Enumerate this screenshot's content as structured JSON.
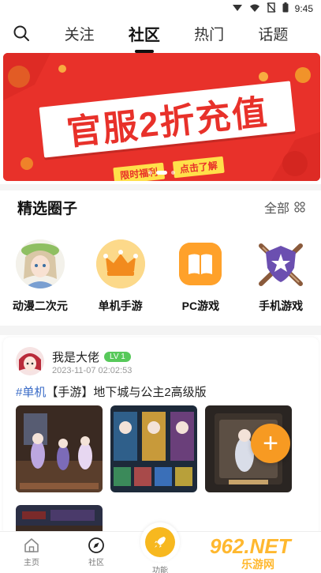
{
  "status_bar": {
    "time": "9:45"
  },
  "top_nav": {
    "tabs": [
      {
        "label": "关注"
      },
      {
        "label": "社区",
        "active": true
      },
      {
        "label": "热门"
      },
      {
        "label": "话题"
      }
    ]
  },
  "banner": {
    "title": "官服2折充值",
    "tags": [
      "限时福利",
      "点击了解"
    ],
    "colors": {
      "background": "#e8312a",
      "accent": "#ffe04a"
    }
  },
  "featured": {
    "title": "精选圈子",
    "view_all": "全部",
    "circles": [
      {
        "label": "动漫二次元",
        "icon": "anime-girl-avatar"
      },
      {
        "label": "单机手游",
        "icon": "crown-icon"
      },
      {
        "label": "PC游戏",
        "icon": "book-icon"
      },
      {
        "label": "手机游戏",
        "icon": "shield-swords-icon"
      }
    ]
  },
  "post": {
    "user": "我是大佬",
    "level": "LV 1",
    "time": "2023-11-07 02:02:53",
    "tag": "#单机",
    "title": "【手游】地下城与公主2高级版"
  },
  "fab": {
    "label": "+"
  },
  "bottom_nav": {
    "items": [
      {
        "label": "主页",
        "icon": "home-icon"
      },
      {
        "label": "社区",
        "icon": "compass-icon"
      },
      {
        "label": "功能",
        "icon": "rocket-icon"
      }
    ]
  },
  "watermark": {
    "text": "962.NET",
    "sub": "乐游网"
  }
}
